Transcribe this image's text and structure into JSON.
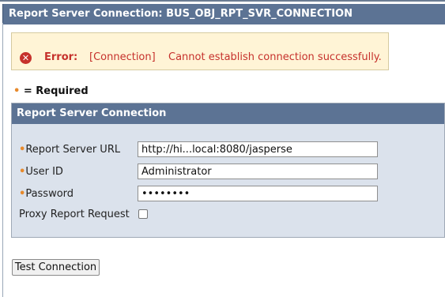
{
  "page": {
    "title": "Report Server Connection: BUS_OBJ_RPT_SVR_CONNECTION"
  },
  "error": {
    "icon": "error-circle-icon",
    "label": "Error:",
    "tag": "[Connection]",
    "message": "Cannot establish connection successfully."
  },
  "required_note": {
    "bullet": "•",
    "text": " = Required"
  },
  "panel": {
    "title": "Report Server Connection",
    "fields": {
      "url": {
        "label": "Report Server URL",
        "value": "http://hi...local:8080/jasperse",
        "required": true
      },
      "user_id": {
        "label": "User ID",
        "value": "Administrator",
        "required": true
      },
      "password": {
        "label": "Password",
        "value": "••••••••",
        "required": true
      },
      "proxy": {
        "label": "Proxy Report Request",
        "checked": false
      }
    }
  },
  "buttons": {
    "test_connection": "Test Connection"
  },
  "colors": {
    "header_bg": "#5c7394",
    "panel_bg": "#dbe2ec",
    "error_bg": "#fff4d6",
    "error_text": "#c6312c",
    "required_bullet": "#e88a2c"
  }
}
